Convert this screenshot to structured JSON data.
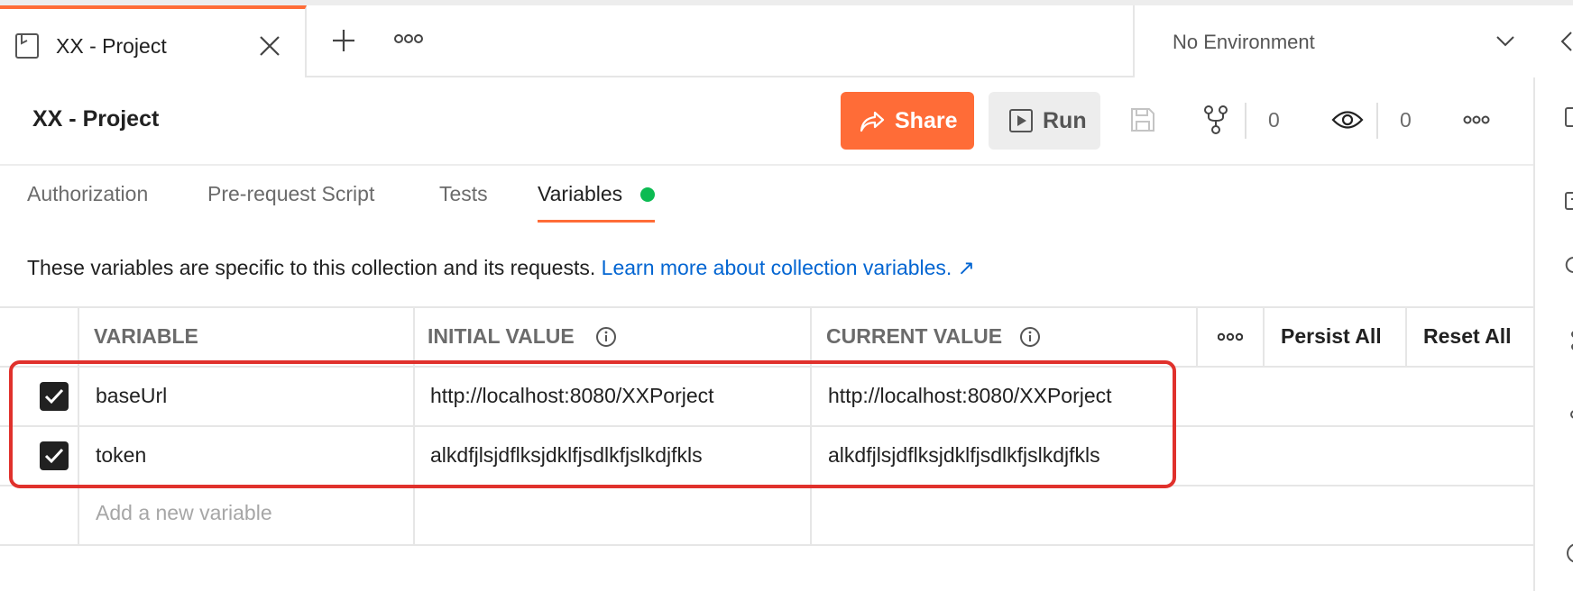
{
  "tab": {
    "title": "XX - Project"
  },
  "environment": {
    "label": "No Environment"
  },
  "header": {
    "title": "XX - Project",
    "share_label": "Share",
    "run_label": "Run",
    "fork_count": "0",
    "watch_count": "0"
  },
  "subtabs": [
    {
      "label": "Authorization"
    },
    {
      "label": "Pre-request Script"
    },
    {
      "label": "Tests"
    },
    {
      "label": "Variables"
    }
  ],
  "info": {
    "text": "These variables are specific to this collection and its requests.",
    "link": "Learn more about collection variables. ↗"
  },
  "table": {
    "headers": {
      "variable": "VARIABLE",
      "initial": "INITIAL VALUE",
      "current": "CURRENT VALUE"
    },
    "persist_all": "Persist All",
    "reset_all": "Reset All",
    "rows": [
      {
        "checked": true,
        "variable": "baseUrl",
        "initial": "http://localhost:8080/XXPorject",
        "current": "http://localhost:8080/XXPorject"
      },
      {
        "checked": true,
        "variable": "token",
        "initial": "alkdfjlsjdflksjdklfjsdlkfjslkdjfkls",
        "current": "alkdfjlsjdflksjdklfjsdlkfjslkdjfkls"
      }
    ],
    "add_placeholder": "Add a new variable"
  },
  "colors": {
    "accent": "#ff6c37",
    "link": "#0265d2",
    "status_dot": "#0cbb52",
    "highlight": "#e0312c"
  }
}
